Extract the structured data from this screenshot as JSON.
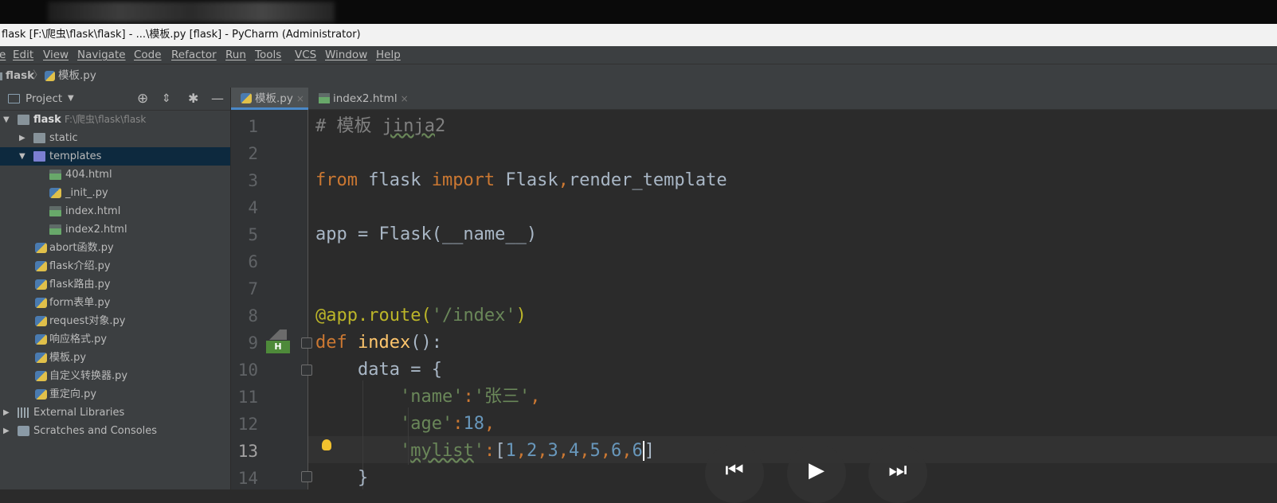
{
  "window": {
    "title": "flask [F:\\爬虫\\flask\\flask] - ...\\模板.py [flask] - PyCharm (Administrator)"
  },
  "menu": {
    "items": [
      "e",
      "Edit",
      "View",
      "Navigate",
      "Code",
      "Refactor",
      "Run",
      "Tools",
      "VCS",
      "Window",
      "Help"
    ]
  },
  "breadcrumb": {
    "root": "flask",
    "file": "模板.py"
  },
  "project_panel": {
    "title": "Project",
    "root": {
      "name": "flask",
      "path": "F:\\爬虫\\flask\\flask"
    },
    "items": [
      {
        "label": "static",
        "kind": "folder"
      },
      {
        "label": "templates",
        "kind": "folder",
        "selected": true
      },
      {
        "label": "404.html",
        "kind": "html"
      },
      {
        "label": "_init_.py",
        "kind": "py"
      },
      {
        "label": "index.html",
        "kind": "html"
      },
      {
        "label": "index2.html",
        "kind": "html"
      },
      {
        "label": "abort函数.py",
        "kind": "py"
      },
      {
        "label": "flask介绍.py",
        "kind": "py"
      },
      {
        "label": "flask路由.py",
        "kind": "py"
      },
      {
        "label": "form表单.py",
        "kind": "py"
      },
      {
        "label": "request对象.py",
        "kind": "py"
      },
      {
        "label": "响应格式.py",
        "kind": "py"
      },
      {
        "label": "模板.py",
        "kind": "py"
      },
      {
        "label": "自定义转换器.py",
        "kind": "py"
      },
      {
        "label": "重定向.py",
        "kind": "py"
      },
      {
        "label": "External Libraries",
        "kind": "lib"
      },
      {
        "label": "Scratches and Consoles",
        "kind": "scratch"
      }
    ]
  },
  "tabs": [
    {
      "label": "模板.py",
      "active": true
    },
    {
      "label": "index2.html",
      "active": false
    }
  ],
  "editor": {
    "line_numbers": [
      "1",
      "2",
      "3",
      "4",
      "5",
      "6",
      "7",
      "8",
      "9",
      "10",
      "11",
      "12",
      "13",
      "14"
    ],
    "current_line": 13
  },
  "colors": {
    "keyword": "#cc7832",
    "string": "#6a8759",
    "number": "#6897bb",
    "decorator": "#bbb529",
    "function": "#ffc66d",
    "selection": "#0d293e"
  },
  "media_controls": {
    "icons": [
      "skip-previous-icon",
      "play-icon",
      "skip-next-icon"
    ]
  }
}
